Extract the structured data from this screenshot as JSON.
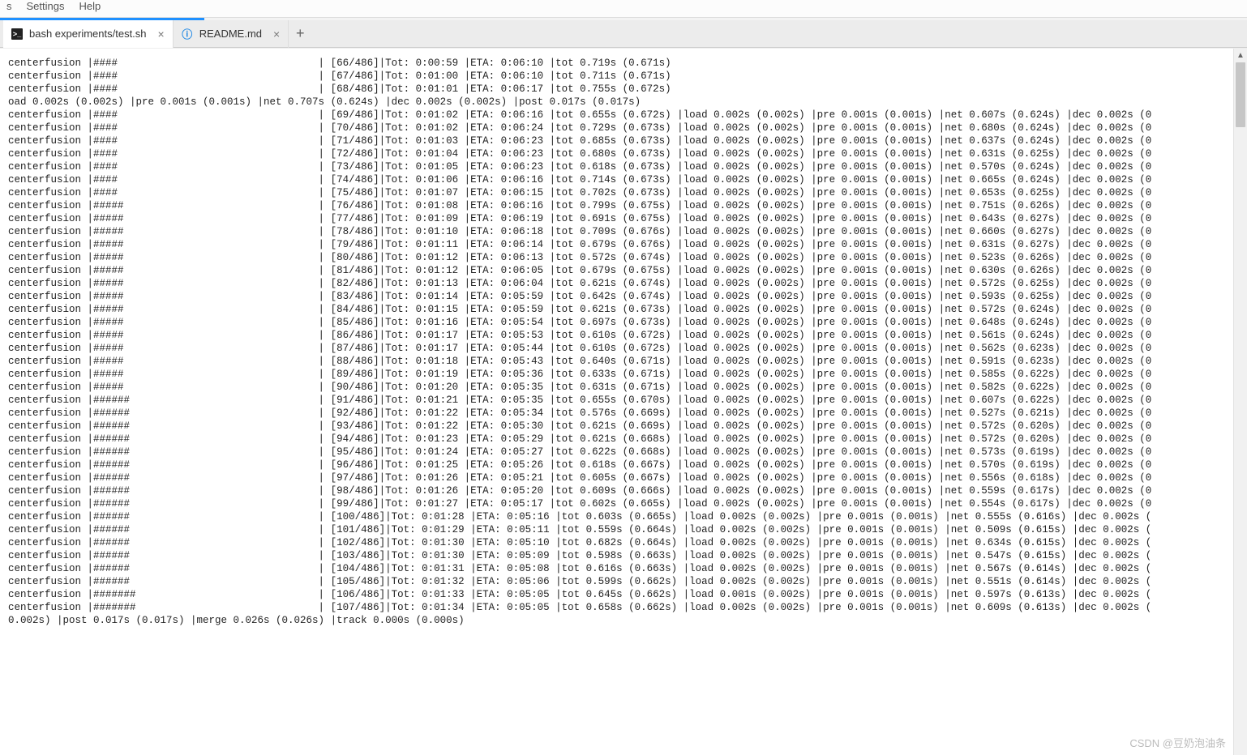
{
  "menu": {
    "items": [
      "s",
      "Settings",
      "Help"
    ]
  },
  "tabs": [
    {
      "icon": "term",
      "label": "bash experiments/test.sh",
      "active": true
    },
    {
      "icon": "info",
      "label": "README.md",
      "active": false
    }
  ],
  "watermark": "CSDN @豆奶泡油条",
  "progressBarWidth": 37,
  "lines": [
    {
      "t": "row",
      "tag": "centerfusion",
      "hashes": 4,
      "idx": 66,
      "total": 486,
      "tot": "0:00:59",
      "eta": "0:06:10",
      "tt": "0.719s",
      "tta": "0.671s",
      "ext": false
    },
    {
      "t": "row",
      "tag": "centerfusion",
      "hashes": 4,
      "idx": 67,
      "total": 486,
      "tot": "0:01:00",
      "eta": "0:06:10",
      "tt": "0.711s",
      "tta": "0.671s",
      "ext": false
    },
    {
      "t": "row",
      "tag": "centerfusion",
      "hashes": 4,
      "idx": 68,
      "total": 486,
      "tot": "0:01:01",
      "eta": "0:06:17",
      "tt": "0.755s",
      "tta": "0.672s",
      "ext": false
    },
    {
      "t": "raw",
      "text": "oad 0.002s (0.002s) |pre 0.001s (0.001s) |net 0.707s (0.624s) |dec 0.002s (0.002s) |post 0.017s (0.017s)"
    },
    {
      "t": "row",
      "tag": "centerfusion",
      "hashes": 4,
      "idx": 69,
      "total": 486,
      "tot": "0:01:02",
      "eta": "0:06:16",
      "tt": "0.655s",
      "tta": "0.672s",
      "ext": true,
      "ld": "0.002s",
      "lda": "0.002s",
      "pr": "0.001s",
      "pra": "0.001s",
      "nt": "0.607s",
      "nta": "0.624s",
      "dc": "0.002s"
    },
    {
      "t": "row",
      "tag": "centerfusion",
      "hashes": 4,
      "idx": 70,
      "total": 486,
      "tot": "0:01:02",
      "eta": "0:06:24",
      "tt": "0.729s",
      "tta": "0.673s",
      "ext": true,
      "ld": "0.002s",
      "lda": "0.002s",
      "pr": "0.001s",
      "pra": "0.001s",
      "nt": "0.680s",
      "nta": "0.624s",
      "dc": "0.002s"
    },
    {
      "t": "row",
      "tag": "centerfusion",
      "hashes": 4,
      "idx": 71,
      "total": 486,
      "tot": "0:01:03",
      "eta": "0:06:23",
      "tt": "0.685s",
      "tta": "0.673s",
      "ext": true,
      "ld": "0.002s",
      "lda": "0.002s",
      "pr": "0.001s",
      "pra": "0.001s",
      "nt": "0.637s",
      "nta": "0.624s",
      "dc": "0.002s"
    },
    {
      "t": "row",
      "tag": "centerfusion",
      "hashes": 4,
      "idx": 72,
      "total": 486,
      "tot": "0:01:04",
      "eta": "0:06:23",
      "tt": "0.680s",
      "tta": "0.673s",
      "ext": true,
      "ld": "0.002s",
      "lda": "0.002s",
      "pr": "0.001s",
      "pra": "0.001s",
      "nt": "0.631s",
      "nta": "0.625s",
      "dc": "0.002s"
    },
    {
      "t": "row",
      "tag": "centerfusion",
      "hashes": 4,
      "idx": 73,
      "total": 486,
      "tot": "0:01:05",
      "eta": "0:06:23",
      "tt": "0.618s",
      "tta": "0.673s",
      "ext": true,
      "ld": "0.002s",
      "lda": "0.002s",
      "pr": "0.001s",
      "pra": "0.001s",
      "nt": "0.570s",
      "nta": "0.624s",
      "dc": "0.002s"
    },
    {
      "t": "row",
      "tag": "centerfusion",
      "hashes": 4,
      "idx": 74,
      "total": 486,
      "tot": "0:01:06",
      "eta": "0:06:16",
      "tt": "0.714s",
      "tta": "0.673s",
      "ext": true,
      "ld": "0.002s",
      "lda": "0.002s",
      "pr": "0.001s",
      "pra": "0.001s",
      "nt": "0.665s",
      "nta": "0.624s",
      "dc": "0.002s"
    },
    {
      "t": "row",
      "tag": "centerfusion",
      "hashes": 4,
      "idx": 75,
      "total": 486,
      "tot": "0:01:07",
      "eta": "0:06:15",
      "tt": "0.702s",
      "tta": "0.673s",
      "ext": true,
      "ld": "0.002s",
      "lda": "0.002s",
      "pr": "0.001s",
      "pra": "0.001s",
      "nt": "0.653s",
      "nta": "0.625s",
      "dc": "0.002s"
    },
    {
      "t": "row",
      "tag": "centerfusion",
      "hashes": 5,
      "idx": 76,
      "total": 486,
      "tot": "0:01:08",
      "eta": "0:06:16",
      "tt": "0.799s",
      "tta": "0.675s",
      "ext": true,
      "ld": "0.002s",
      "lda": "0.002s",
      "pr": "0.001s",
      "pra": "0.001s",
      "nt": "0.751s",
      "nta": "0.626s",
      "dc": "0.002s"
    },
    {
      "t": "row",
      "tag": "centerfusion",
      "hashes": 5,
      "idx": 77,
      "total": 486,
      "tot": "0:01:09",
      "eta": "0:06:19",
      "tt": "0.691s",
      "tta": "0.675s",
      "ext": true,
      "ld": "0.002s",
      "lda": "0.002s",
      "pr": "0.001s",
      "pra": "0.001s",
      "nt": "0.643s",
      "nta": "0.627s",
      "dc": "0.002s"
    },
    {
      "t": "row",
      "tag": "centerfusion",
      "hashes": 5,
      "idx": 78,
      "total": 486,
      "tot": "0:01:10",
      "eta": "0:06:18",
      "tt": "0.709s",
      "tta": "0.676s",
      "ext": true,
      "ld": "0.002s",
      "lda": "0.002s",
      "pr": "0.001s",
      "pra": "0.001s",
      "nt": "0.660s",
      "nta": "0.627s",
      "dc": "0.002s"
    },
    {
      "t": "row",
      "tag": "centerfusion",
      "hashes": 5,
      "idx": 79,
      "total": 486,
      "tot": "0:01:11",
      "eta": "0:06:14",
      "tt": "0.679s",
      "tta": "0.676s",
      "ext": true,
      "ld": "0.002s",
      "lda": "0.002s",
      "pr": "0.001s",
      "pra": "0.001s",
      "nt": "0.631s",
      "nta": "0.627s",
      "dc": "0.002s"
    },
    {
      "t": "row",
      "tag": "centerfusion",
      "hashes": 5,
      "idx": 80,
      "total": 486,
      "tot": "0:01:12",
      "eta": "0:06:13",
      "tt": "0.572s",
      "tta": "0.674s",
      "ext": true,
      "ld": "0.002s",
      "lda": "0.002s",
      "pr": "0.001s",
      "pra": "0.001s",
      "nt": "0.523s",
      "nta": "0.626s",
      "dc": "0.002s"
    },
    {
      "t": "row",
      "tag": "centerfusion",
      "hashes": 5,
      "idx": 81,
      "total": 486,
      "tot": "0:01:12",
      "eta": "0:06:05",
      "tt": "0.679s",
      "tta": "0.675s",
      "ext": true,
      "ld": "0.002s",
      "lda": "0.002s",
      "pr": "0.001s",
      "pra": "0.001s",
      "nt": "0.630s",
      "nta": "0.626s",
      "dc": "0.002s"
    },
    {
      "t": "row",
      "tag": "centerfusion",
      "hashes": 5,
      "idx": 82,
      "total": 486,
      "tot": "0:01:13",
      "eta": "0:06:04",
      "tt": "0.621s",
      "tta": "0.674s",
      "ext": true,
      "ld": "0.002s",
      "lda": "0.002s",
      "pr": "0.001s",
      "pra": "0.001s",
      "nt": "0.572s",
      "nta": "0.625s",
      "dc": "0.002s"
    },
    {
      "t": "row",
      "tag": "centerfusion",
      "hashes": 5,
      "idx": 83,
      "total": 486,
      "tot": "0:01:14",
      "eta": "0:05:59",
      "tt": "0.642s",
      "tta": "0.674s",
      "ext": true,
      "ld": "0.002s",
      "lda": "0.002s",
      "pr": "0.001s",
      "pra": "0.001s",
      "nt": "0.593s",
      "nta": "0.625s",
      "dc": "0.002s"
    },
    {
      "t": "row",
      "tag": "centerfusion",
      "hashes": 5,
      "idx": 84,
      "total": 486,
      "tot": "0:01:15",
      "eta": "0:05:59",
      "tt": "0.621s",
      "tta": "0.673s",
      "ext": true,
      "ld": "0.002s",
      "lda": "0.002s",
      "pr": "0.001s",
      "pra": "0.001s",
      "nt": "0.572s",
      "nta": "0.624s",
      "dc": "0.002s"
    },
    {
      "t": "row",
      "tag": "centerfusion",
      "hashes": 5,
      "idx": 85,
      "total": 486,
      "tot": "0:01:16",
      "eta": "0:05:54",
      "tt": "0.697s",
      "tta": "0.673s",
      "ext": true,
      "ld": "0.002s",
      "lda": "0.002s",
      "pr": "0.001s",
      "pra": "0.001s",
      "nt": "0.648s",
      "nta": "0.624s",
      "dc": "0.002s"
    },
    {
      "t": "row",
      "tag": "centerfusion",
      "hashes": 5,
      "idx": 86,
      "total": 486,
      "tot": "0:01:17",
      "eta": "0:05:53",
      "tt": "0.610s",
      "tta": "0.672s",
      "ext": true,
      "ld": "0.002s",
      "lda": "0.002s",
      "pr": "0.001s",
      "pra": "0.001s",
      "nt": "0.561s",
      "nta": "0.624s",
      "dc": "0.002s"
    },
    {
      "t": "row",
      "tag": "centerfusion",
      "hashes": 5,
      "idx": 87,
      "total": 486,
      "tot": "0:01:17",
      "eta": "0:05:44",
      "tt": "0.610s",
      "tta": "0.672s",
      "ext": true,
      "ld": "0.002s",
      "lda": "0.002s",
      "pr": "0.001s",
      "pra": "0.001s",
      "nt": "0.562s",
      "nta": "0.623s",
      "dc": "0.002s"
    },
    {
      "t": "row",
      "tag": "centerfusion",
      "hashes": 5,
      "idx": 88,
      "total": 486,
      "tot": "0:01:18",
      "eta": "0:05:43",
      "tt": "0.640s",
      "tta": "0.671s",
      "ext": true,
      "ld": "0.002s",
      "lda": "0.002s",
      "pr": "0.001s",
      "pra": "0.001s",
      "nt": "0.591s",
      "nta": "0.623s",
      "dc": "0.002s"
    },
    {
      "t": "row",
      "tag": "centerfusion",
      "hashes": 5,
      "idx": 89,
      "total": 486,
      "tot": "0:01:19",
      "eta": "0:05:36",
      "tt": "0.633s",
      "tta": "0.671s",
      "ext": true,
      "ld": "0.002s",
      "lda": "0.002s",
      "pr": "0.001s",
      "pra": "0.001s",
      "nt": "0.585s",
      "nta": "0.622s",
      "dc": "0.002s"
    },
    {
      "t": "row",
      "tag": "centerfusion",
      "hashes": 5,
      "idx": 90,
      "total": 486,
      "tot": "0:01:20",
      "eta": "0:05:35",
      "tt": "0.631s",
      "tta": "0.671s",
      "ext": true,
      "ld": "0.002s",
      "lda": "0.002s",
      "pr": "0.001s",
      "pra": "0.001s",
      "nt": "0.582s",
      "nta": "0.622s",
      "dc": "0.002s"
    },
    {
      "t": "row",
      "tag": "centerfusion",
      "hashes": 6,
      "idx": 91,
      "total": 486,
      "tot": "0:01:21",
      "eta": "0:05:35",
      "tt": "0.655s",
      "tta": "0.670s",
      "ext": true,
      "ld": "0.002s",
      "lda": "0.002s",
      "pr": "0.001s",
      "pra": "0.001s",
      "nt": "0.607s",
      "nta": "0.622s",
      "dc": "0.002s"
    },
    {
      "t": "row",
      "tag": "centerfusion",
      "hashes": 6,
      "idx": 92,
      "total": 486,
      "tot": "0:01:22",
      "eta": "0:05:34",
      "tt": "0.576s",
      "tta": "0.669s",
      "ext": true,
      "ld": "0.002s",
      "lda": "0.002s",
      "pr": "0.001s",
      "pra": "0.001s",
      "nt": "0.527s",
      "nta": "0.621s",
      "dc": "0.002s"
    },
    {
      "t": "row",
      "tag": "centerfusion",
      "hashes": 6,
      "idx": 93,
      "total": 486,
      "tot": "0:01:22",
      "eta": "0:05:30",
      "tt": "0.621s",
      "tta": "0.669s",
      "ext": true,
      "ld": "0.002s",
      "lda": "0.002s",
      "pr": "0.001s",
      "pra": "0.001s",
      "nt": "0.572s",
      "nta": "0.620s",
      "dc": "0.002s"
    },
    {
      "t": "row",
      "tag": "centerfusion",
      "hashes": 6,
      "idx": 94,
      "total": 486,
      "tot": "0:01:23",
      "eta": "0:05:29",
      "tt": "0.621s",
      "tta": "0.668s",
      "ext": true,
      "ld": "0.002s",
      "lda": "0.002s",
      "pr": "0.001s",
      "pra": "0.001s",
      "nt": "0.572s",
      "nta": "0.620s",
      "dc": "0.002s"
    },
    {
      "t": "row",
      "tag": "centerfusion",
      "hashes": 6,
      "idx": 95,
      "total": 486,
      "tot": "0:01:24",
      "eta": "0:05:27",
      "tt": "0.622s",
      "tta": "0.668s",
      "ext": true,
      "ld": "0.002s",
      "lda": "0.002s",
      "pr": "0.001s",
      "pra": "0.001s",
      "nt": "0.573s",
      "nta": "0.619s",
      "dc": "0.002s"
    },
    {
      "t": "row",
      "tag": "centerfusion",
      "hashes": 6,
      "idx": 96,
      "total": 486,
      "tot": "0:01:25",
      "eta": "0:05:26",
      "tt": "0.618s",
      "tta": "0.667s",
      "ext": true,
      "ld": "0.002s",
      "lda": "0.002s",
      "pr": "0.001s",
      "pra": "0.001s",
      "nt": "0.570s",
      "nta": "0.619s",
      "dc": "0.002s"
    },
    {
      "t": "row",
      "tag": "centerfusion",
      "hashes": 6,
      "idx": 97,
      "total": 486,
      "tot": "0:01:26",
      "eta": "0:05:21",
      "tt": "0.605s",
      "tta": "0.667s",
      "ext": true,
      "ld": "0.002s",
      "lda": "0.002s",
      "pr": "0.001s",
      "pra": "0.001s",
      "nt": "0.556s",
      "nta": "0.618s",
      "dc": "0.002s"
    },
    {
      "t": "row",
      "tag": "centerfusion",
      "hashes": 6,
      "idx": 98,
      "total": 486,
      "tot": "0:01:26",
      "eta": "0:05:20",
      "tt": "0.609s",
      "tta": "0.666s",
      "ext": true,
      "ld": "0.002s",
      "lda": "0.002s",
      "pr": "0.001s",
      "pra": "0.001s",
      "nt": "0.559s",
      "nta": "0.617s",
      "dc": "0.002s"
    },
    {
      "t": "row",
      "tag": "centerfusion",
      "hashes": 6,
      "idx": 99,
      "total": 486,
      "tot": "0:01:27",
      "eta": "0:05:17",
      "tt": "0.602s",
      "tta": "0.665s",
      "ext": true,
      "ld": "0.002s",
      "lda": "0.002s",
      "pr": "0.001s",
      "pra": "0.001s",
      "nt": "0.554s",
      "nta": "0.617s",
      "dc": "0.002s"
    },
    {
      "t": "row",
      "tag": "centerfusion",
      "hashes": 6,
      "idx": 100,
      "total": 486,
      "tot": "0:01:28",
      "eta": "0:05:16",
      "tt": "0.603s",
      "tta": "0.665s",
      "ext": true,
      "wide": true,
      "ld": "0.002s",
      "lda": "0.002s",
      "pr": "0.001s",
      "pra": "0.001s",
      "nt": "0.555s",
      "nta": "0.616s",
      "dc": "0.002s"
    },
    {
      "t": "row",
      "tag": "centerfusion",
      "hashes": 6,
      "idx": 101,
      "total": 486,
      "tot": "0:01:29",
      "eta": "0:05:11",
      "tt": "0.559s",
      "tta": "0.664s",
      "ext": true,
      "wide": true,
      "ld": "0.002s",
      "lda": "0.002s",
      "pr": "0.001s",
      "pra": "0.001s",
      "nt": "0.509s",
      "nta": "0.615s",
      "dc": "0.002s"
    },
    {
      "t": "row",
      "tag": "centerfusion",
      "hashes": 6,
      "idx": 102,
      "total": 486,
      "tot": "0:01:30",
      "eta": "0:05:10",
      "tt": "0.682s",
      "tta": "0.664s",
      "ext": true,
      "wide": true,
      "ld": "0.002s",
      "lda": "0.002s",
      "pr": "0.001s",
      "pra": "0.001s",
      "nt": "0.634s",
      "nta": "0.615s",
      "dc": "0.002s"
    },
    {
      "t": "row",
      "tag": "centerfusion",
      "hashes": 6,
      "idx": 103,
      "total": 486,
      "tot": "0:01:30",
      "eta": "0:05:09",
      "tt": "0.598s",
      "tta": "0.663s",
      "ext": true,
      "wide": true,
      "ld": "0.002s",
      "lda": "0.002s",
      "pr": "0.001s",
      "pra": "0.001s",
      "nt": "0.547s",
      "nta": "0.615s",
      "dc": "0.002s"
    },
    {
      "t": "row",
      "tag": "centerfusion",
      "hashes": 6,
      "idx": 104,
      "total": 486,
      "tot": "0:01:31",
      "eta": "0:05:08",
      "tt": "0.616s",
      "tta": "0.663s",
      "ext": true,
      "wide": true,
      "ld": "0.002s",
      "lda": "0.002s",
      "pr": "0.001s",
      "pra": "0.001s",
      "nt": "0.567s",
      "nta": "0.614s",
      "dc": "0.002s"
    },
    {
      "t": "row",
      "tag": "centerfusion",
      "hashes": 6,
      "idx": 105,
      "total": 486,
      "tot": "0:01:32",
      "eta": "0:05:06",
      "tt": "0.599s",
      "tta": "0.662s",
      "ext": true,
      "wide": true,
      "ld": "0.002s",
      "lda": "0.002s",
      "pr": "0.001s",
      "pra": "0.001s",
      "nt": "0.551s",
      "nta": "0.614s",
      "dc": "0.002s"
    },
    {
      "t": "row",
      "tag": "centerfusion",
      "hashes": 7,
      "idx": 106,
      "total": 486,
      "tot": "0:01:33",
      "eta": "0:05:05",
      "tt": "0.645s",
      "tta": "0.662s",
      "ext": true,
      "wide": true,
      "ld": "0.001s",
      "lda": "0.002s",
      "pr": "0.001s",
      "pra": "0.001s",
      "nt": "0.597s",
      "nta": "0.613s",
      "dc": "0.002s"
    },
    {
      "t": "row",
      "tag": "centerfusion",
      "hashes": 7,
      "idx": 107,
      "total": 486,
      "tot": "0:01:34",
      "eta": "0:05:05",
      "tt": "0.658s",
      "tta": "0.662s",
      "ext": true,
      "wide": true,
      "ld": "0.002s",
      "lda": "0.002s",
      "pr": "0.001s",
      "pra": "0.001s",
      "nt": "0.609s",
      "nta": "0.613s",
      "dc": "0.002s"
    },
    {
      "t": "raw",
      "text": "0.002s) |post 0.017s (0.017s) |merge 0.026s (0.026s) |track 0.000s (0.000s)"
    }
  ]
}
